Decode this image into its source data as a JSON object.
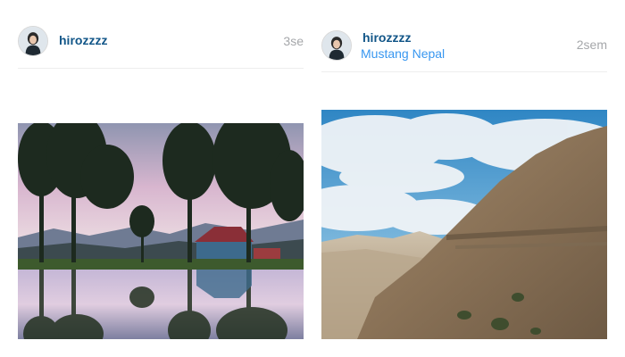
{
  "feed": {
    "posts": [
      {
        "username": "hirozzzz",
        "timestamp": "3se",
        "photo_subject": "lake-barn-trees-photo"
      },
      {
        "username": "hirozzzz",
        "location": "Mustang Nepal",
        "timestamp": "2sem",
        "photo_subject": "mountain-cliff-photo"
      }
    ]
  },
  "colors": {
    "username": "#125688",
    "location": "#3897f0",
    "timestamp": "#a5a7aa",
    "divider": "#eeeeee"
  }
}
